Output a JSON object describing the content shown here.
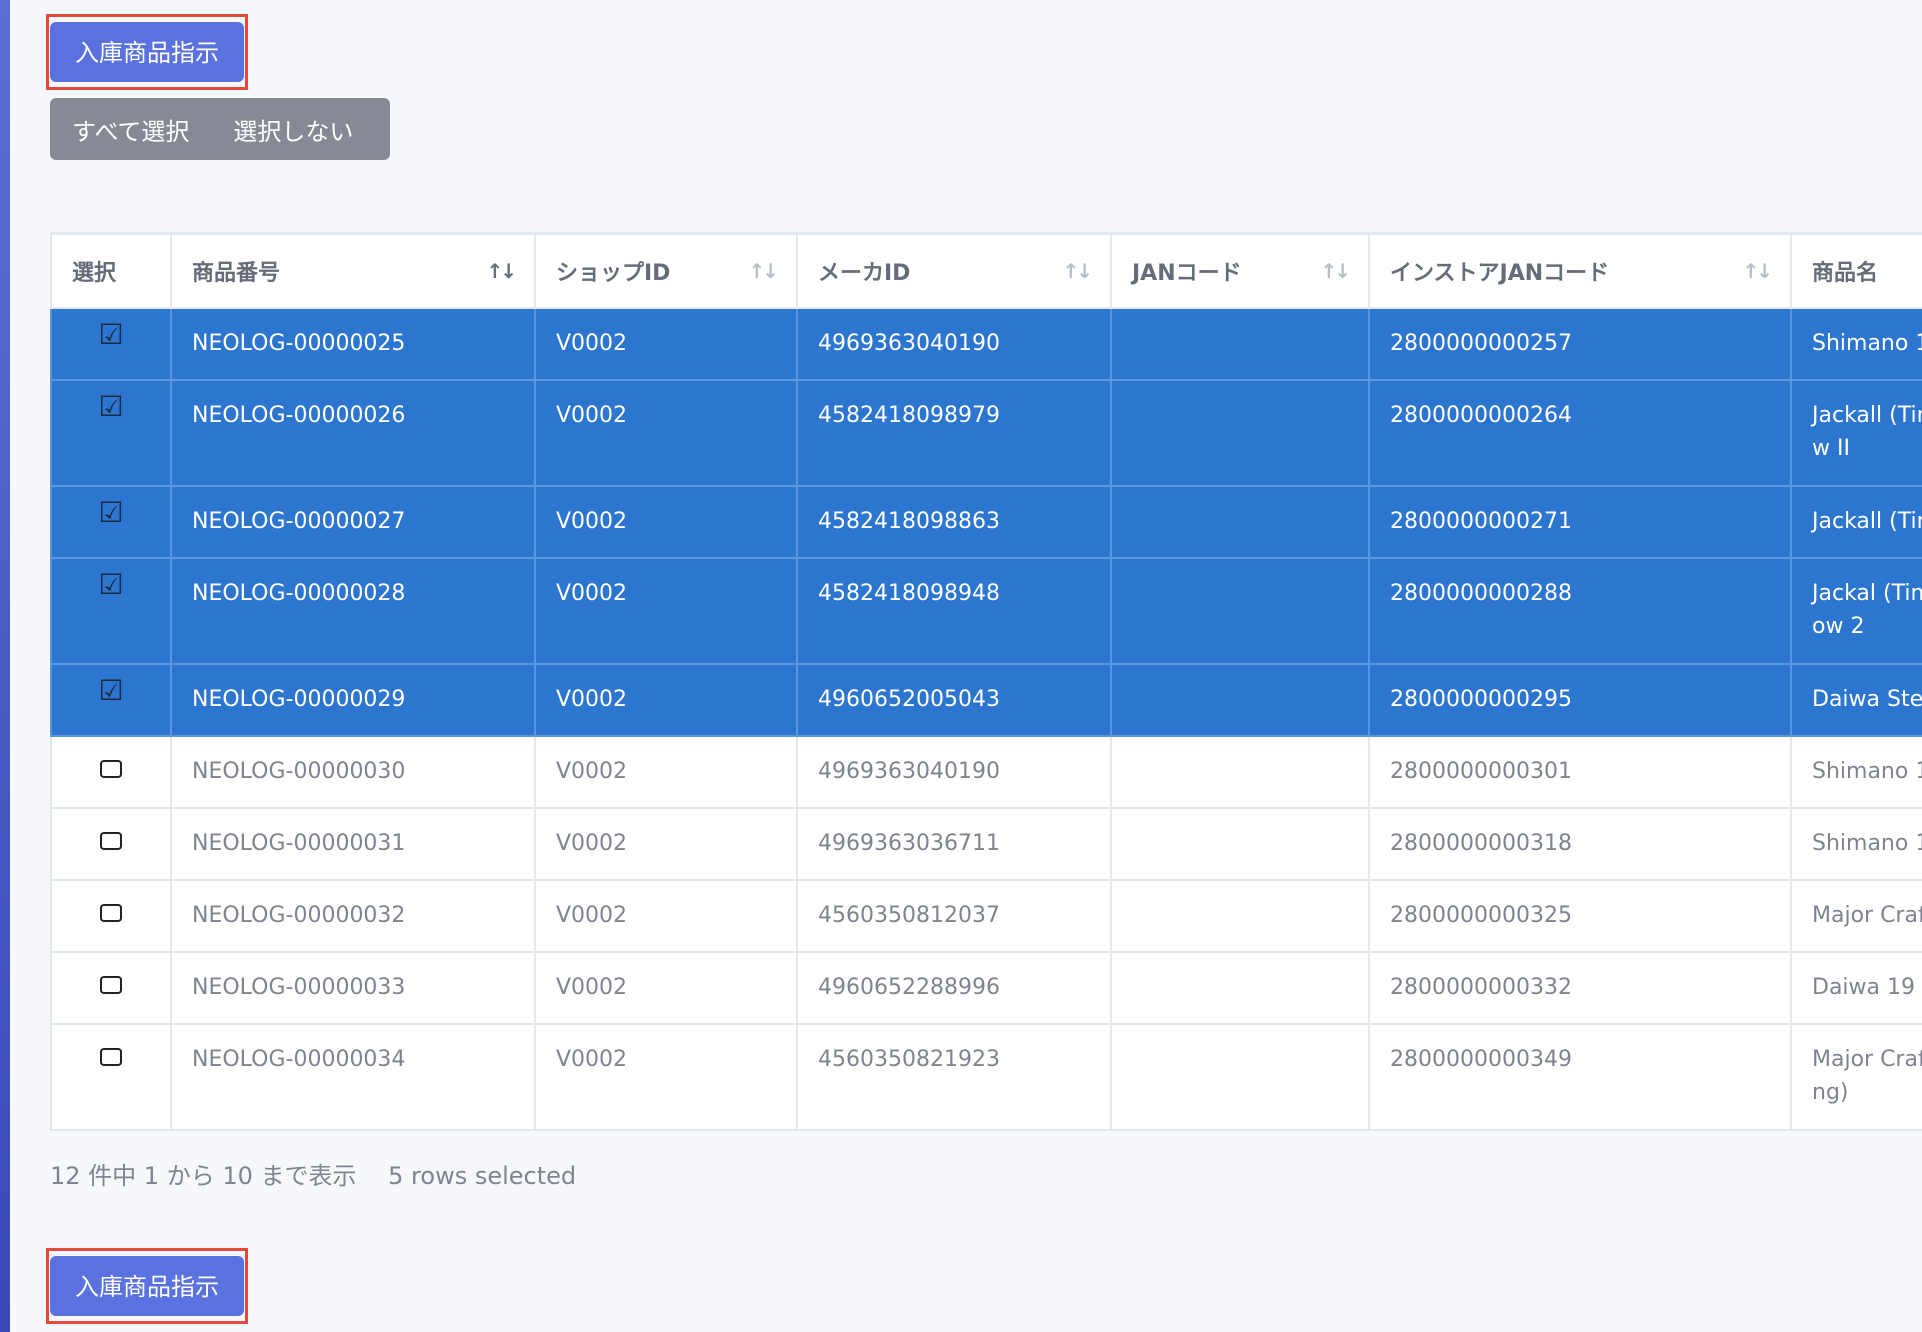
{
  "actions": {
    "submit_label": "入庫商品指示",
    "select_all": "すべて選択",
    "select_none": "選択しない"
  },
  "colors": {
    "primary": "#5a72e0",
    "selected_row": "#2d76d0",
    "highlight": "#e34a3a"
  },
  "table": {
    "headers": [
      "選択",
      "商品番号",
      "ショップID",
      "メーカID",
      "JANコード",
      "インストアJANコード",
      "商品名"
    ],
    "sort_indicator": "↑↓",
    "rows": [
      {
        "selected": true,
        "item_no": "NEOLOG-00000025",
        "shop_id": "V0002",
        "maker_id": "4969363040190",
        "jan": "",
        "instore_jan": "2800000000257",
        "name": "Shimano 1"
      },
      {
        "selected": true,
        "item_no": "NEOLOG-00000026",
        "shop_id": "V0002",
        "maker_id": "4582418098979",
        "jan": "",
        "instore_jan": "2800000000264",
        "name": "Jackall (Tin",
        "name2": "w II"
      },
      {
        "selected": true,
        "item_no": "NEOLOG-00000027",
        "shop_id": "V0002",
        "maker_id": "4582418098863",
        "jan": "",
        "instore_jan": "2800000000271",
        "name": "Jackall (Tin"
      },
      {
        "selected": true,
        "item_no": "NEOLOG-00000028",
        "shop_id": "V0002",
        "maker_id": "4582418098948",
        "jan": "",
        "instore_jan": "2800000000288",
        "name": "Jackal (Tim",
        "name2": "ow 2"
      },
      {
        "selected": true,
        "item_no": "NEOLOG-00000029",
        "shop_id": "V0002",
        "maker_id": "4960652005043",
        "jan": "",
        "instore_jan": "2800000000295",
        "name": "Daiwa Stee"
      },
      {
        "selected": false,
        "item_no": "NEOLOG-00000030",
        "shop_id": "V0002",
        "maker_id": "4969363040190",
        "jan": "",
        "instore_jan": "2800000000301",
        "name": "Shimano 1"
      },
      {
        "selected": false,
        "item_no": "NEOLOG-00000031",
        "shop_id": "V0002",
        "maker_id": "4969363036711",
        "jan": "",
        "instore_jan": "2800000000318",
        "name": "Shimano 1"
      },
      {
        "selected": false,
        "item_no": "NEOLOG-00000032",
        "shop_id": "V0002",
        "maker_id": "4560350812037",
        "jan": "",
        "instore_jan": "2800000000325",
        "name": "Major Craf"
      },
      {
        "selected": false,
        "item_no": "NEOLOG-00000033",
        "shop_id": "V0002",
        "maker_id": "4960652288996",
        "jan": "",
        "instore_jan": "2800000000332",
        "name": "Daiwa 19 I"
      },
      {
        "selected": false,
        "item_no": "NEOLOG-00000034",
        "shop_id": "V0002",
        "maker_id": "4560350821923",
        "jan": "",
        "instore_jan": "2800000000349",
        "name": "Major Craf",
        "name2": "ng)"
      }
    ]
  },
  "footer": {
    "range_text": "12 件中 1 から 10 まで表示",
    "selection_text": "5 rows selected"
  }
}
